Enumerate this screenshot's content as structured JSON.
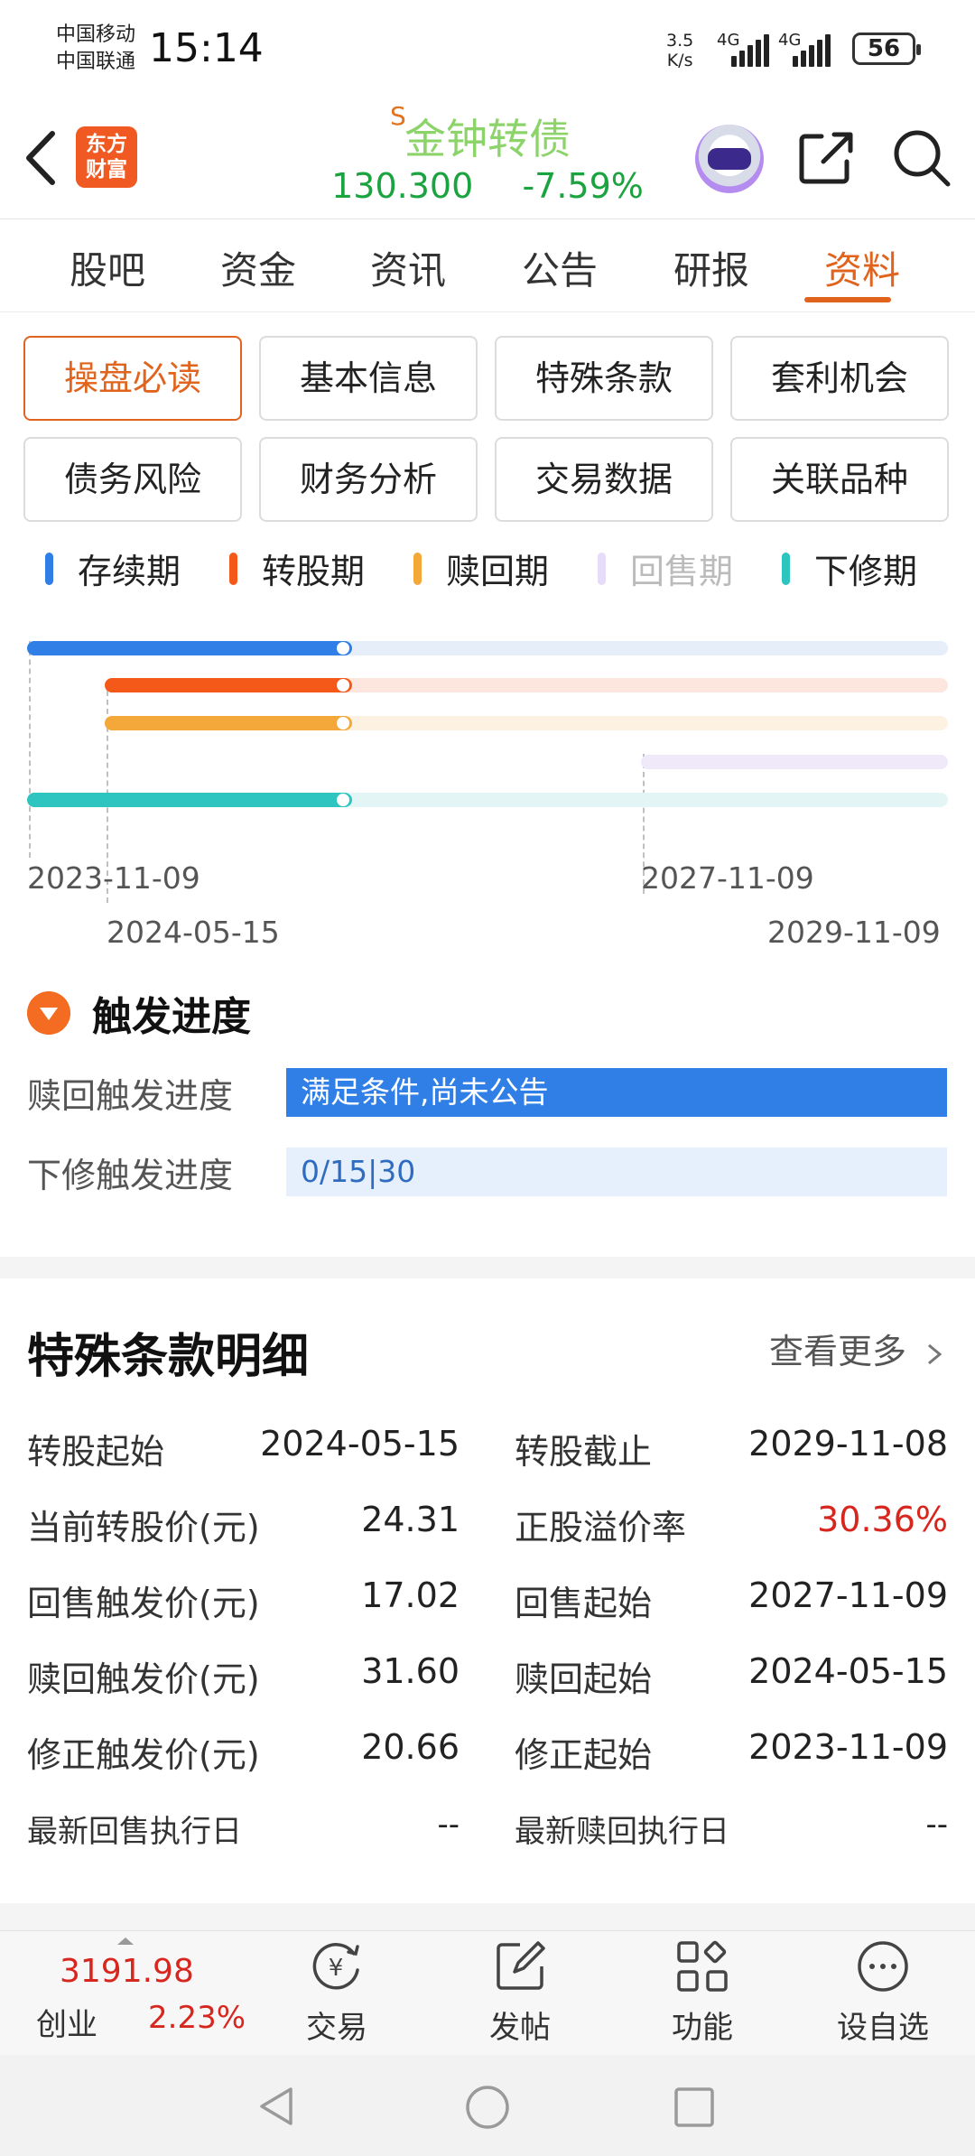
{
  "status_bar": {
    "carrier1": "中国移动",
    "carrier2": "中国联通",
    "time": "15:14",
    "speed_value": "3.5",
    "speed_unit": "K/s",
    "net1": "4G",
    "net2": "4G",
    "battery": "56"
  },
  "header": {
    "logo_line1": "东方",
    "logo_line2": "财富",
    "stock_prefix": "S",
    "stock_name": "金钟转债",
    "price": "130.300",
    "change": "-7.59%"
  },
  "tabs": [
    {
      "label": "股吧"
    },
    {
      "label": "资金"
    },
    {
      "label": "资讯"
    },
    {
      "label": "公告"
    },
    {
      "label": "研报"
    },
    {
      "label": "资料"
    }
  ],
  "subtabs": [
    {
      "label": "操盘必读"
    },
    {
      "label": "基本信息"
    },
    {
      "label": "特殊条款"
    },
    {
      "label": "套利机会"
    },
    {
      "label": "债务风险"
    },
    {
      "label": "财务分析"
    },
    {
      "label": "交易数据"
    },
    {
      "label": "关联品种"
    }
  ],
  "legend": [
    {
      "label": "存续期",
      "color": "#2f7fe6"
    },
    {
      "label": "转股期",
      "color": "#f5591a"
    },
    {
      "label": "赎回期",
      "color": "#f5a83a"
    },
    {
      "label": "回售期",
      "color": "#e6dcf7"
    },
    {
      "label": "下修期",
      "color": "#2ec4c0"
    }
  ],
  "timeline": {
    "start_date": "2023-11-09",
    "convert_start": "2024-05-15",
    "putback_start": "2027-11-09",
    "end_date": "2029-11-09"
  },
  "trigger": {
    "title": "触发进度",
    "redeem_label": "赎回触发进度",
    "redeem_value": "满足条件,尚未公告",
    "revise_label": "下修触发进度",
    "revise_value": "0/15|30"
  },
  "details": {
    "title": "特殊条款明细",
    "more": "查看更多",
    "rows": [
      {
        "l1": "转股起始",
        "v1": "2024-05-15",
        "l2": "转股截止",
        "v2": "2029-11-08"
      },
      {
        "l1": "当前转股价(元)",
        "v1": "24.31",
        "l2": "正股溢价率",
        "v2": "30.36%"
      },
      {
        "l1": "回售触发价(元)",
        "v1": "17.02",
        "l2": "回售起始",
        "v2": "2027-11-09"
      },
      {
        "l1": "赎回触发价(元)",
        "v1": "31.60",
        "l2": "赎回起始",
        "v2": "2024-05-15"
      },
      {
        "l1": "修正触发价(元)",
        "v1": "20.66",
        "l2": "修正起始",
        "v2": "2023-11-09"
      },
      {
        "l1": "最新回售执行日",
        "v1": "--",
        "l2": "最新赎回执行日",
        "v2": "--"
      }
    ]
  },
  "bottom_bar": {
    "index_value": "3191.98",
    "index_name": "创业",
    "index_change": "2.23%",
    "trade": "交易",
    "post": "发帖",
    "function": "功能",
    "watchlist": "设自选"
  }
}
